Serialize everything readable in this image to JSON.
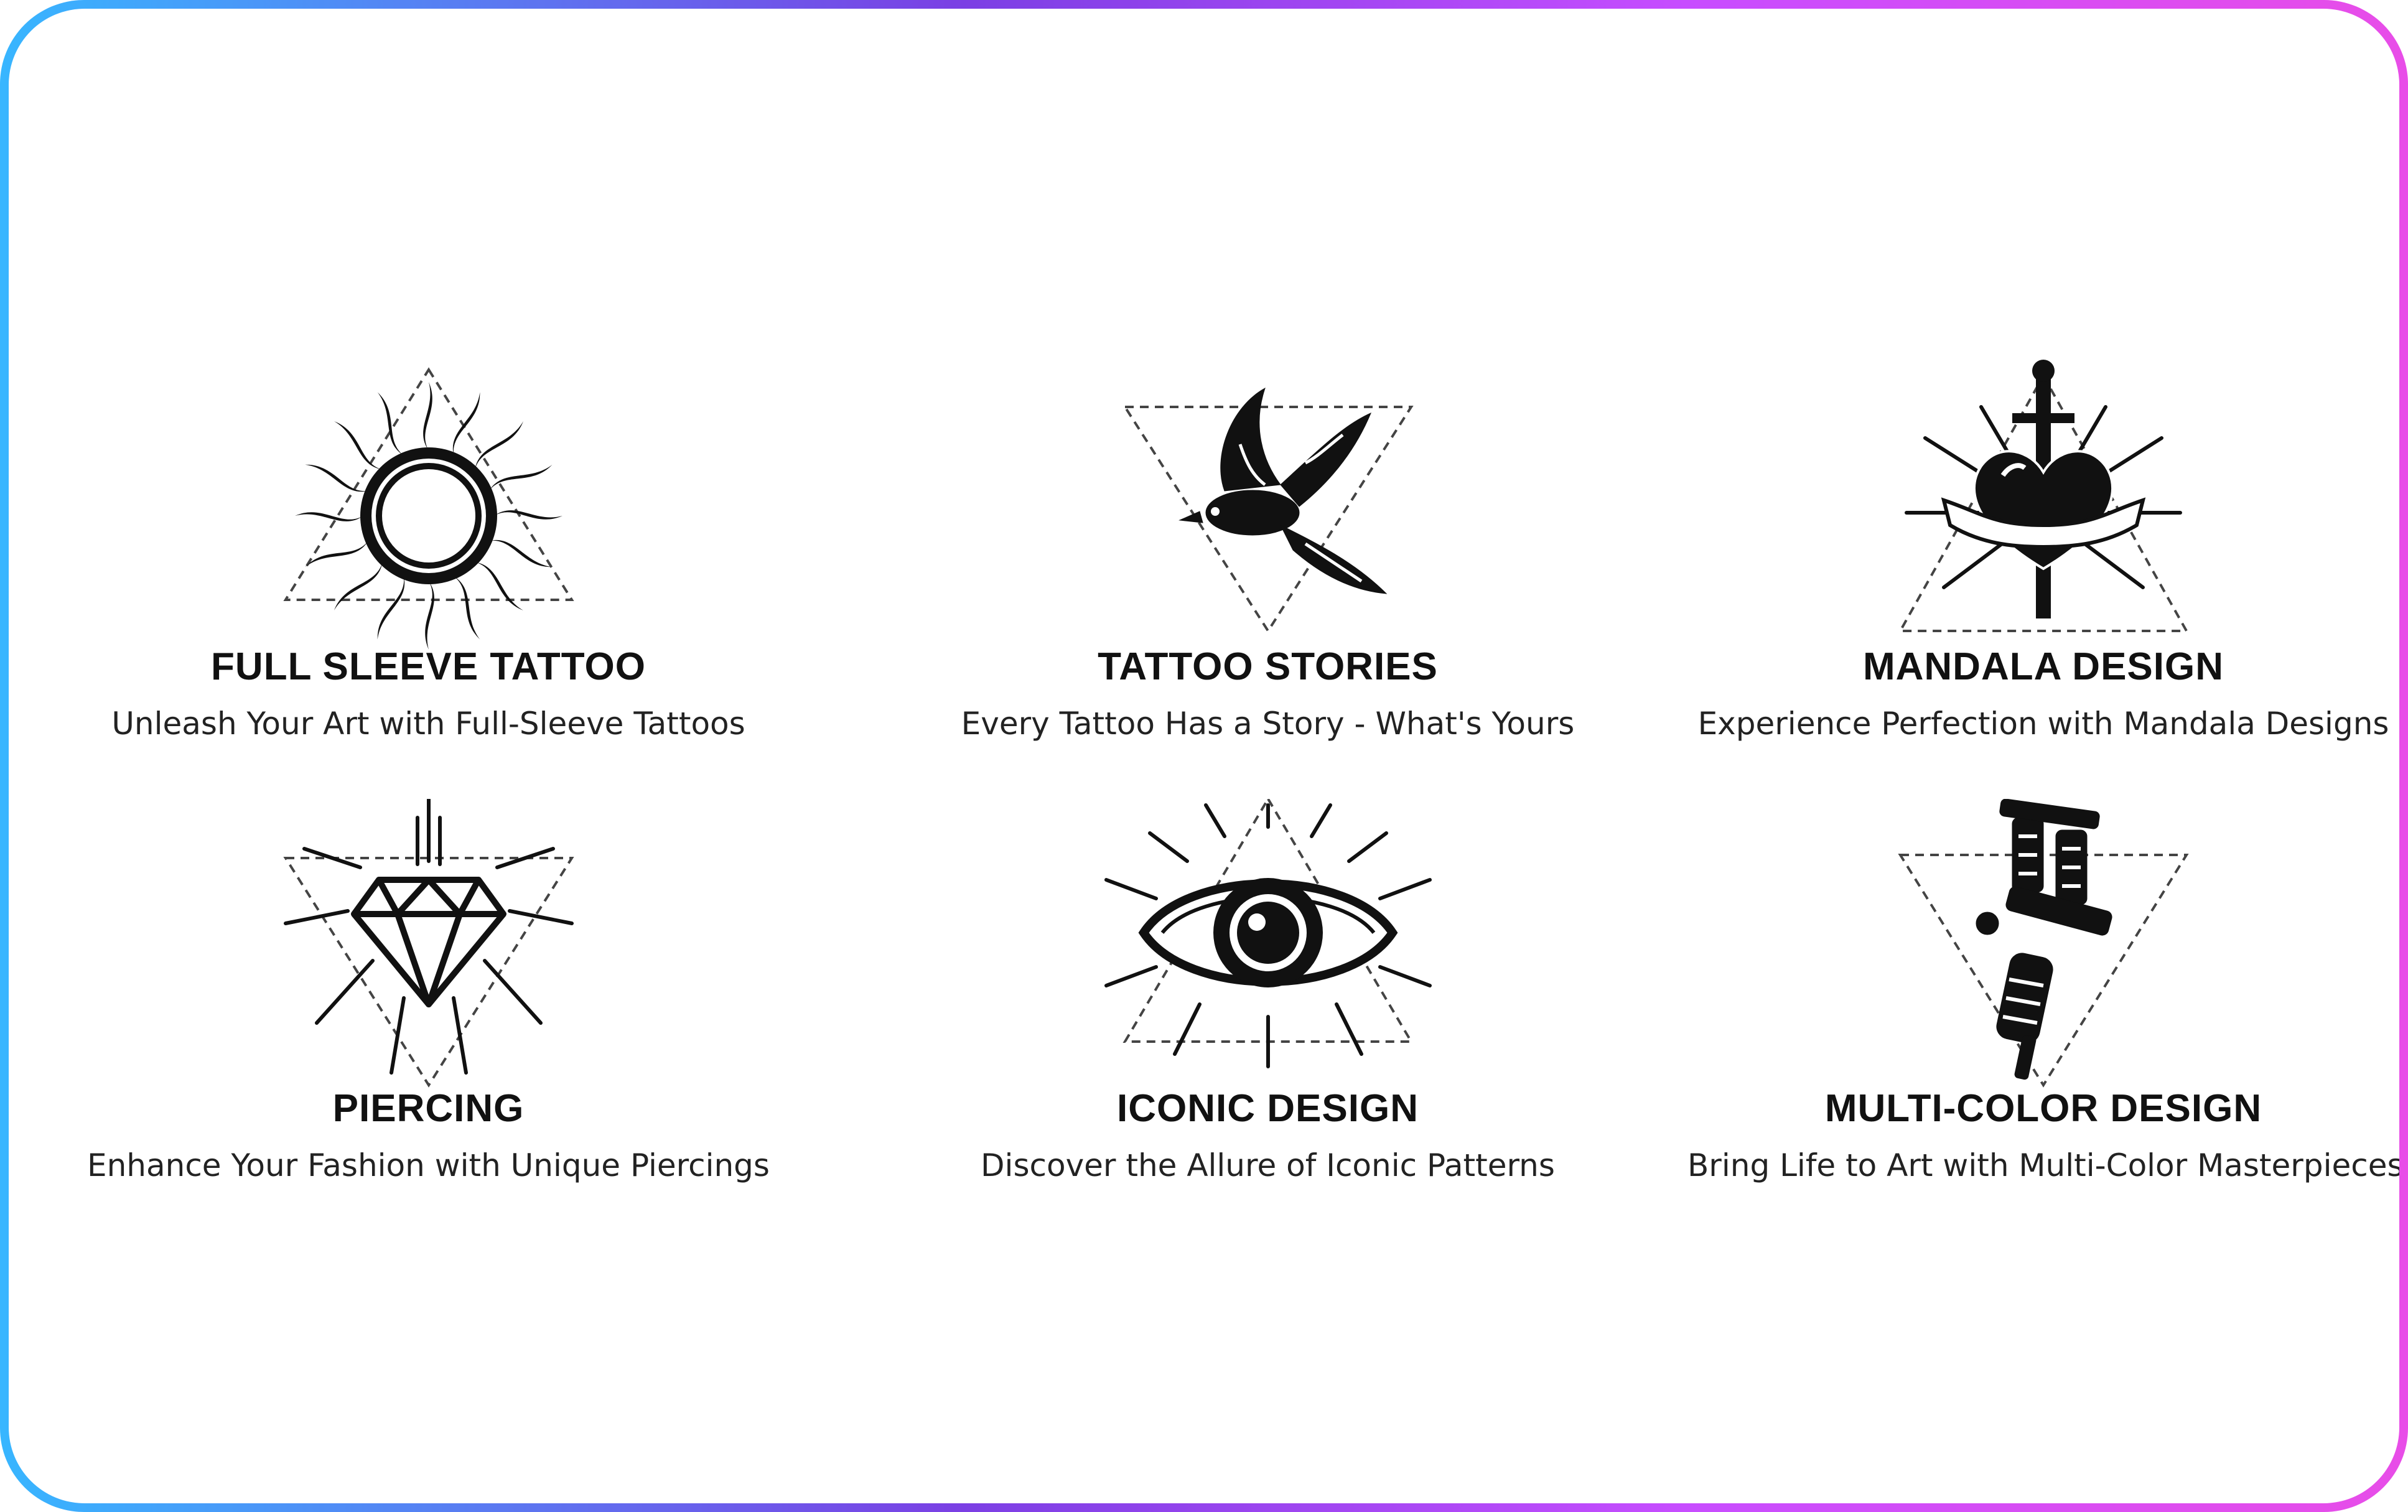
{
  "services": [
    {
      "title": "FULL SLEEVE TATTOO",
      "subtitle": "Unleash Your Art with Full-Sleeve Tattoos",
      "icon": "sun-tattoo-icon"
    },
    {
      "title": "TATTOO STORIES",
      "subtitle": "Every Tattoo Has a Story - What's Yours",
      "icon": "swallow-tattoo-icon"
    },
    {
      "title": "MANDALA DESIGN",
      "subtitle": "Experience Perfection with Mandala Designs",
      "icon": "dagger-heart-tattoo-icon"
    },
    {
      "title": "PIERCING",
      "subtitle": "Enhance Your Fashion with Unique Piercings",
      "icon": "diamond-tattoo-icon"
    },
    {
      "title": "ICONIC DESIGN",
      "subtitle": "Discover the Allure of Iconic Patterns",
      "icon": "eye-tattoo-icon"
    },
    {
      "title": "MULTI-COLOR DESIGN",
      "subtitle": "Bring Life to Art with Multi-Color Masterpieces",
      "icon": "tattoo-machine-icon"
    }
  ],
  "colors": {
    "frame_gradient": [
      "#38b6ff",
      "#7b3fe4",
      "#c74dff",
      "#e84de8"
    ],
    "text": "#111111"
  }
}
